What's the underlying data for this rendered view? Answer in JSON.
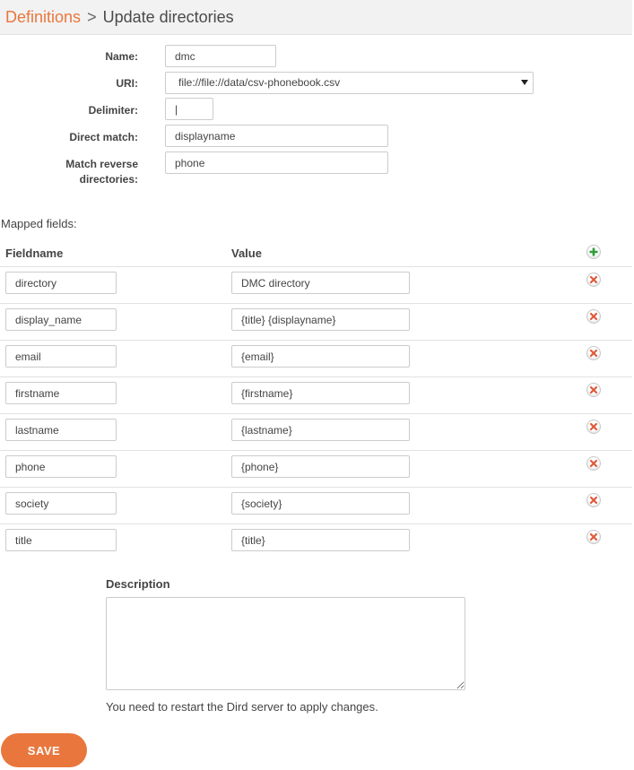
{
  "breadcrumb": {
    "parent": "Definitions",
    "separator": ">",
    "current": "Update directories"
  },
  "form": {
    "name": {
      "label": "Name:",
      "value": "dmc"
    },
    "uri": {
      "label": "URI:",
      "value": "file://file://data/csv-phonebook.csv"
    },
    "delimiter": {
      "label": "Delimiter:",
      "value": "|"
    },
    "direct_match": {
      "label": "Direct match:",
      "value": "displayname"
    },
    "match_reverse": {
      "label_line1": "Match reverse",
      "label_line2": "directories:",
      "value": "phone"
    }
  },
  "mapped": {
    "title": "Mapped fields:",
    "col_fieldname": "Fieldname",
    "col_value": "Value",
    "rows": [
      {
        "field": "directory",
        "value": "DMC directory"
      },
      {
        "field": "display_name",
        "value": "{title} {displayname}"
      },
      {
        "field": "email",
        "value": "{email}"
      },
      {
        "field": "firstname",
        "value": "{firstname}"
      },
      {
        "field": "lastname",
        "value": "{lastname}"
      },
      {
        "field": "phone",
        "value": "{phone}"
      },
      {
        "field": "society",
        "value": "{society}"
      },
      {
        "field": "title",
        "value": "{title}"
      }
    ]
  },
  "description": {
    "label": "Description",
    "value": ""
  },
  "notice": "You need to restart the Dird server to apply changes.",
  "save_label": "SAVE",
  "colors": {
    "accent": "#e9773d",
    "add": "#2e9e3a",
    "remove": "#e05a3a"
  },
  "icons": {
    "add": "plus-circle-icon",
    "remove": "x-circle-icon",
    "select": "caret-down-icon"
  }
}
